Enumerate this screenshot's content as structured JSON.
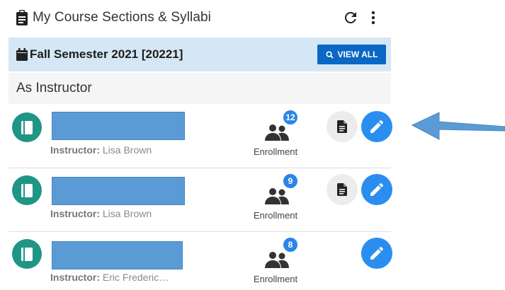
{
  "header": {
    "title": "My Course Sections & Syllabi",
    "icons": [
      "clipboard-icon",
      "refresh-icon",
      "more-vert-icon"
    ]
  },
  "semester": {
    "title": "Fall Semester 2021 [20221]",
    "view_all_label": "VIEW ALL"
  },
  "role_heading": "As Instructor",
  "courses": [
    {
      "instructor_label": "Instructor:",
      "instructor_name": "Lisa Brown",
      "enrollment_count": "12",
      "enrollment_label": "Enrollment",
      "has_syllabus": true
    },
    {
      "instructor_label": "Instructor:",
      "instructor_name": "Lisa Brown",
      "enrollment_count": "9",
      "enrollment_label": "Enrollment",
      "has_syllabus": true
    },
    {
      "instructor_label": "Instructor:",
      "instructor_name": "Eric Frederic…",
      "enrollment_count": "8",
      "enrollment_label": "Enrollment",
      "has_syllabus": false
    }
  ],
  "colors": {
    "semester_bar": "#d5e7f5",
    "view_all_button": "#0a67c3",
    "book_icon_bg": "#1f9586",
    "edit_button": "#2a8ef0",
    "badge": "#2a86e6",
    "annotation_arrow": "#5b9bd5"
  }
}
